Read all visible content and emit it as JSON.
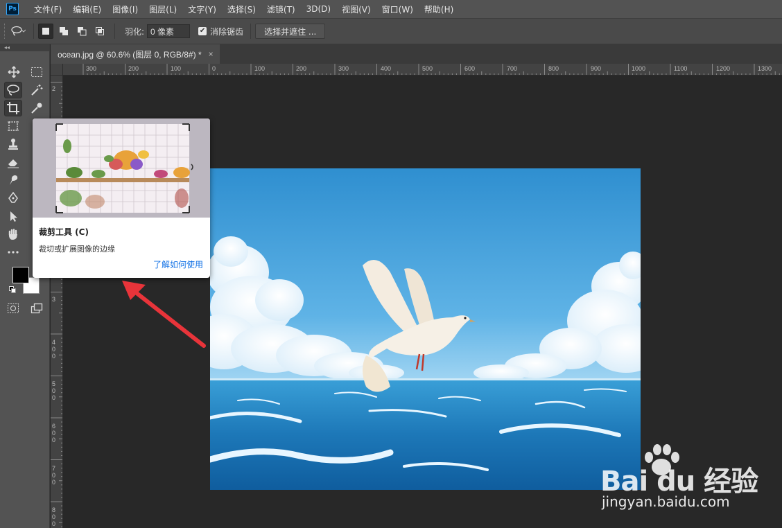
{
  "app": {
    "logo": "Ps"
  },
  "menu": [
    "文件(F)",
    "编辑(E)",
    "图像(I)",
    "图层(L)",
    "文字(Y)",
    "选择(S)",
    "滤镜(T)",
    "3D(D)",
    "视图(V)",
    "窗口(W)",
    "帮助(H)"
  ],
  "options": {
    "tool_icon": "lasso-icon",
    "feather_label": "羽化:",
    "feather_value": "0 像素",
    "antialias_label": "消除锯齿",
    "antialias_checked": true,
    "select_mask_label": "选择并遮住 ..."
  },
  "tab": {
    "title": "ocean.jpg @ 60.6% (图层 0, RGB/8#) *",
    "close": "×"
  },
  "ruler": {
    "top_labels": [
      "300",
      "200",
      "100",
      "0",
      "100",
      "200",
      "300",
      "400",
      "500",
      "600",
      "700",
      "800",
      "900",
      "1000",
      "1100",
      "1200",
      "1300"
    ],
    "left_labels": [
      "2",
      "3",
      "4 0 0",
      "5 0 0",
      "6 0 0",
      "7 0 0",
      "8 0 0"
    ]
  },
  "tooltip": {
    "title": "裁剪工具 (C)",
    "description": "裁切或扩展图像的边缘",
    "link": "了解如何使用"
  },
  "watermark": {
    "brand": "Bai du 经验",
    "url": "jingyan.baidu.com"
  },
  "colors": {
    "menubar": "#535353",
    "panel": "#4a4a4a",
    "canvas": "#282828",
    "accent_link": "#1473e6",
    "arrow": "#e8343a"
  }
}
